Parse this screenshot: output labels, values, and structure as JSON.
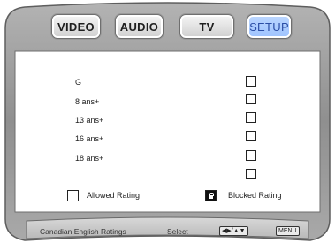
{
  "tabs": [
    {
      "label": "VIDEO"
    },
    {
      "label": "AUDIO"
    },
    {
      "label": "TV"
    },
    {
      "label": "SETUP",
      "active": true
    }
  ],
  "ratings": [
    {
      "label": "G"
    },
    {
      "label": "8 ans+"
    },
    {
      "label": "13 ans+"
    },
    {
      "label": "16 ans+"
    },
    {
      "label": "18 ans+"
    }
  ],
  "legend": {
    "allowed": "Allowed Rating",
    "blocked": "Blocked Rating"
  },
  "status_bar": {
    "title": "Canadian English Ratings",
    "select_label": "Select",
    "arrow_key": "◀▶/▲▼",
    "menu_key": "MENU"
  },
  "colors": {
    "frame": "#8d8d8d",
    "frame_dark": "#5a5a5a",
    "active_tab": "#a6c8ff",
    "active_tab_text": "#2b4ea6"
  }
}
